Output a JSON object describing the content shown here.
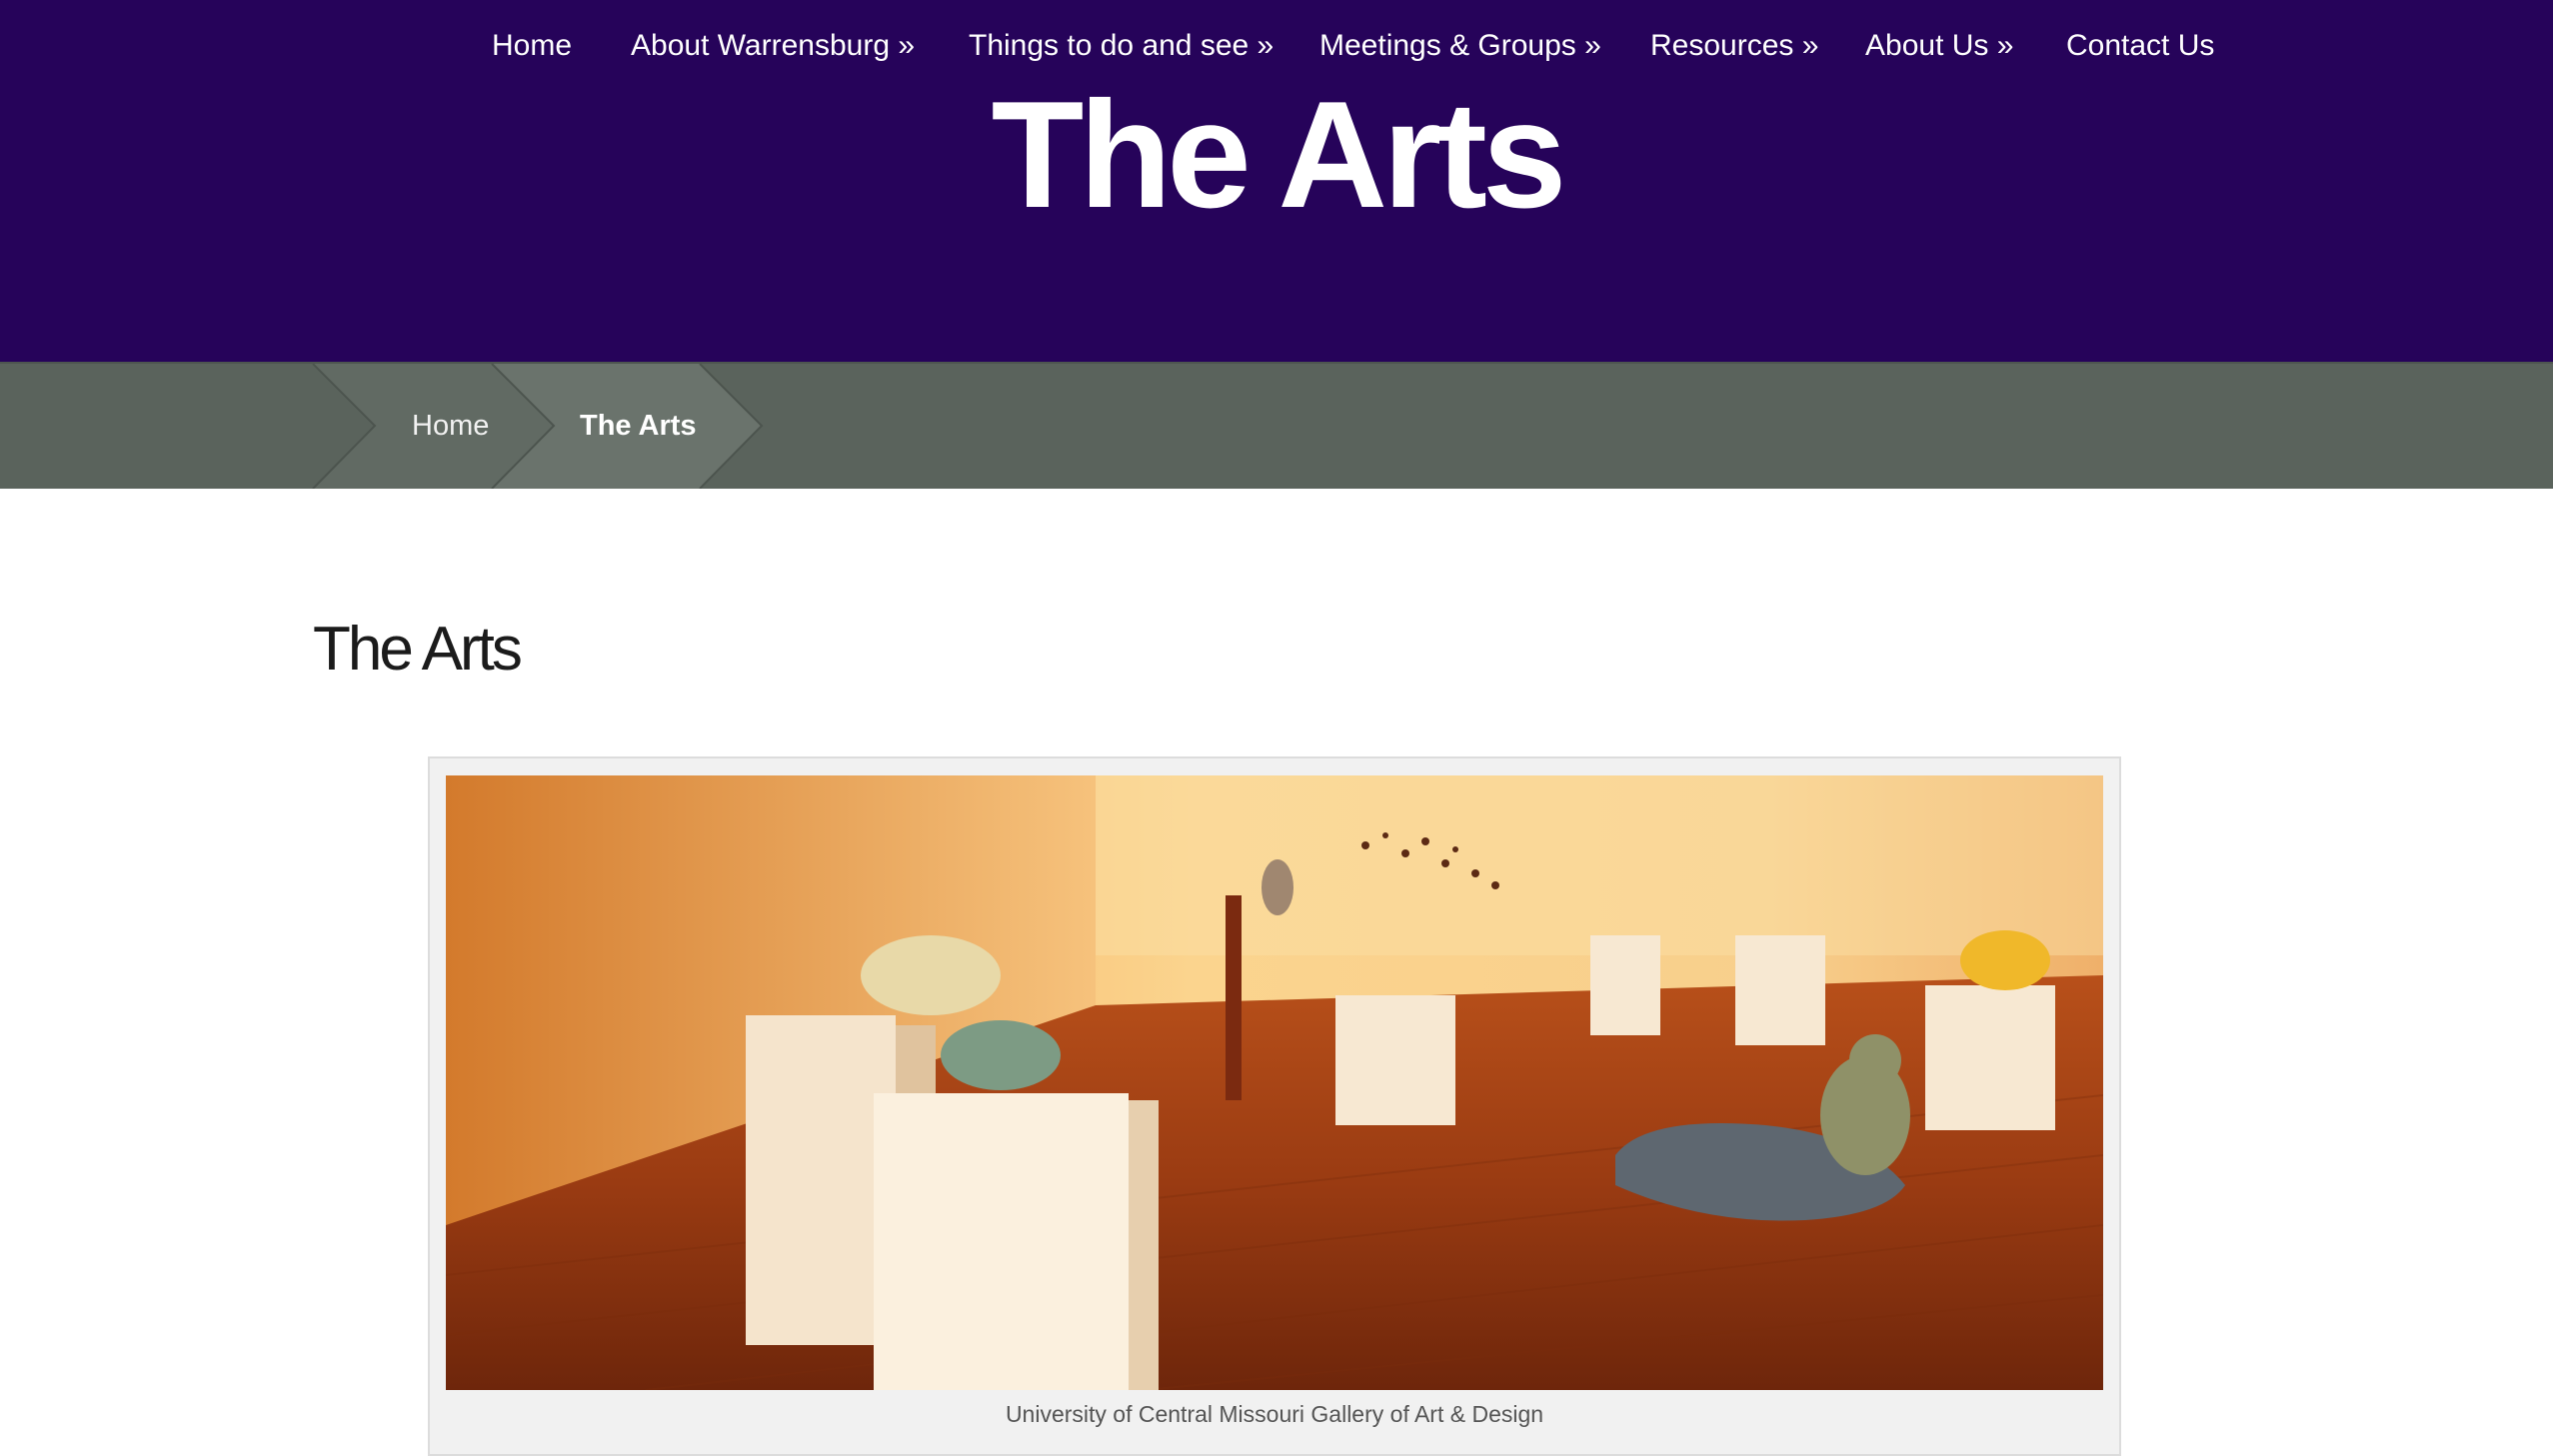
{
  "nav": {
    "items": [
      {
        "label": "Home"
      },
      {
        "label": "About Warrensburg »"
      },
      {
        "label": "Things to do and see »"
      },
      {
        "label": "Meetings & Groups »"
      },
      {
        "label": "Resources »"
      },
      {
        "label": "About Us »"
      },
      {
        "label": "Contact Us"
      }
    ]
  },
  "hero": {
    "title": "The Arts"
  },
  "breadcrumb": {
    "home": "Home",
    "current": "The Arts"
  },
  "content": {
    "heading": "The Arts",
    "figure": {
      "caption": "University of Central Missouri Gallery of Art & Design"
    }
  },
  "colors": {
    "header_bg": "#26035a",
    "breadcrumb_bg": "#5a635c",
    "crumb_segment": "#616a63",
    "crumb_current": "#6a736c"
  }
}
